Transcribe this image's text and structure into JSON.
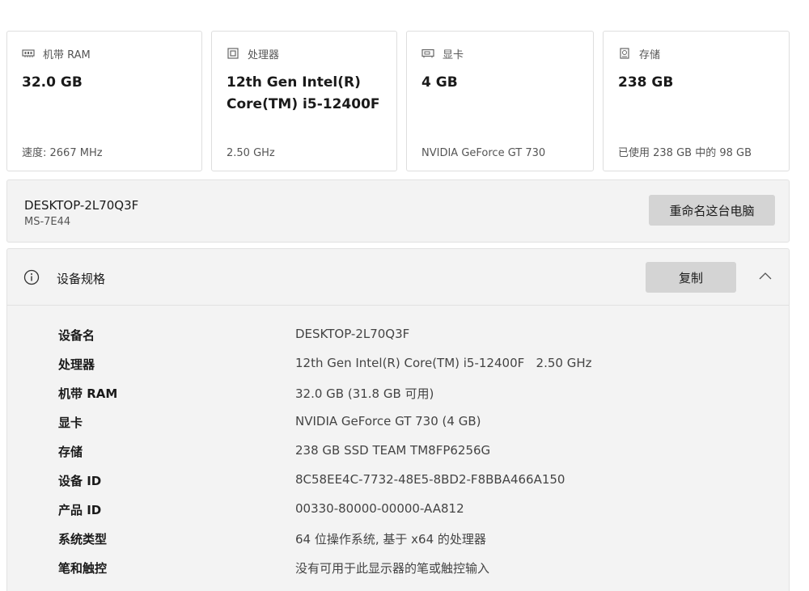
{
  "cards": [
    {
      "icon": "memory-icon",
      "label": "机带 RAM",
      "value": "32.0 GB",
      "sub": "速度: 2667 MHz"
    },
    {
      "icon": "cpu-icon",
      "label": "处理器",
      "value": "12th Gen Intel(R)\nCore(TM) i5-12400F",
      "sub": "2.50 GHz"
    },
    {
      "icon": "display-adapter-icon",
      "label": "显卡",
      "value": "4 GB",
      "sub": "NVIDIA GeForce GT 730"
    },
    {
      "icon": "storage-icon",
      "label": "存储",
      "value": "238 GB",
      "sub": "已使用 238 GB 中的 98 GB"
    }
  ],
  "device": {
    "name": "DESKTOP-2L70Q3F",
    "model": "MS-7E44",
    "rename_label": "重命名这台电脑"
  },
  "specs": {
    "title": "设备规格",
    "copy_label": "复制",
    "rows": [
      {
        "label": "设备名",
        "value": "DESKTOP-2L70Q3F"
      },
      {
        "label": "处理器",
        "value": "12th Gen Intel(R) Core(TM) i5-12400F   2.50 GHz"
      },
      {
        "label": "机带 RAM",
        "value": "32.0 GB (31.8 GB 可用)"
      },
      {
        "label": "显卡",
        "value": "NVIDIA GeForce GT 730 (4 GB)"
      },
      {
        "label": "存储",
        "value": "238 GB SSD TEAM TM8FP6256G"
      },
      {
        "label": "设备 ID",
        "value": "8C58EE4C-7732-48E5-8BD2-F8BBA466A150"
      },
      {
        "label": "产品 ID",
        "value": "00330-80000-00000-AA812"
      },
      {
        "label": "系统类型",
        "value": "64 位操作系统, 基于 x64 的处理器"
      },
      {
        "label": "笔和触控",
        "value": "没有可用于此显示器的笔或触控输入"
      }
    ]
  }
}
